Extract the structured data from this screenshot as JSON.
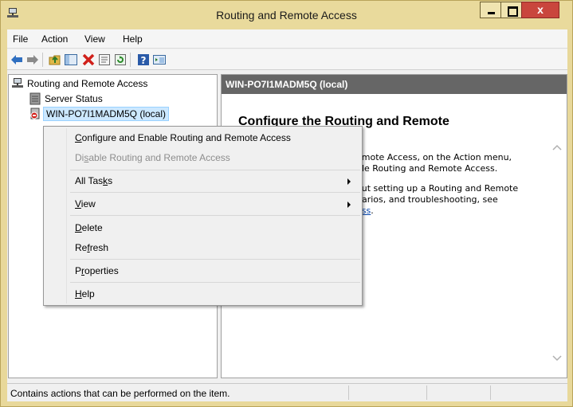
{
  "window": {
    "title": "Routing and Remote Access",
    "close_glyph": "x"
  },
  "menubar": {
    "items": [
      "File",
      "Action",
      "View",
      "Help"
    ]
  },
  "toolbar": {
    "buttons": [
      "back-arrow-icon",
      "forward-arrow-icon",
      "up-folder-icon",
      "show-hide-tree-icon",
      "delete-icon",
      "properties-icon",
      "refresh-icon",
      "help-icon",
      "console-tree-icon"
    ]
  },
  "tree": {
    "root": "Routing and Remote Access",
    "children": [
      {
        "label": "Server Status"
      },
      {
        "label": "WIN-PO7I1MADM5Q (local)"
      }
    ]
  },
  "right_pane": {
    "header": "WIN-PO7I1MADM5Q (local)",
    "heading": "Configure the Routing and Remote",
    "line1": "emote Access, on the Action menu,",
    "line2": "ble Routing and Remote Access.",
    "line3": "out setting up a Routing and Remote",
    "line4": "narios, and troubleshooting, see",
    "link": "ess",
    "link_suffix": "."
  },
  "context_menu": {
    "configure": {
      "before": "",
      "key": "C",
      "after": "onfigure and Enable Routing and Remote Access"
    },
    "disable": {
      "before": "Di",
      "key": "s",
      "after": "able Routing and Remote Access"
    },
    "all_tasks": {
      "before": "All Tas",
      "key": "k",
      "after": "s"
    },
    "view": {
      "before": "",
      "key": "V",
      "after": "iew"
    },
    "delete": {
      "before": "",
      "key": "D",
      "after": "elete"
    },
    "refresh": {
      "before": "Re",
      "key": "f",
      "after": "resh"
    },
    "properties": {
      "before": "P",
      "key": "r",
      "after": "operties"
    },
    "help": {
      "before": "",
      "key": "H",
      "after": "elp"
    }
  },
  "statusbar": {
    "text": "Contains actions that can be performed on the item."
  },
  "colors": {
    "titlebar": "#e9da9c",
    "close": "#c9463d",
    "right_header": "#666666",
    "link": "#0645ad"
  }
}
